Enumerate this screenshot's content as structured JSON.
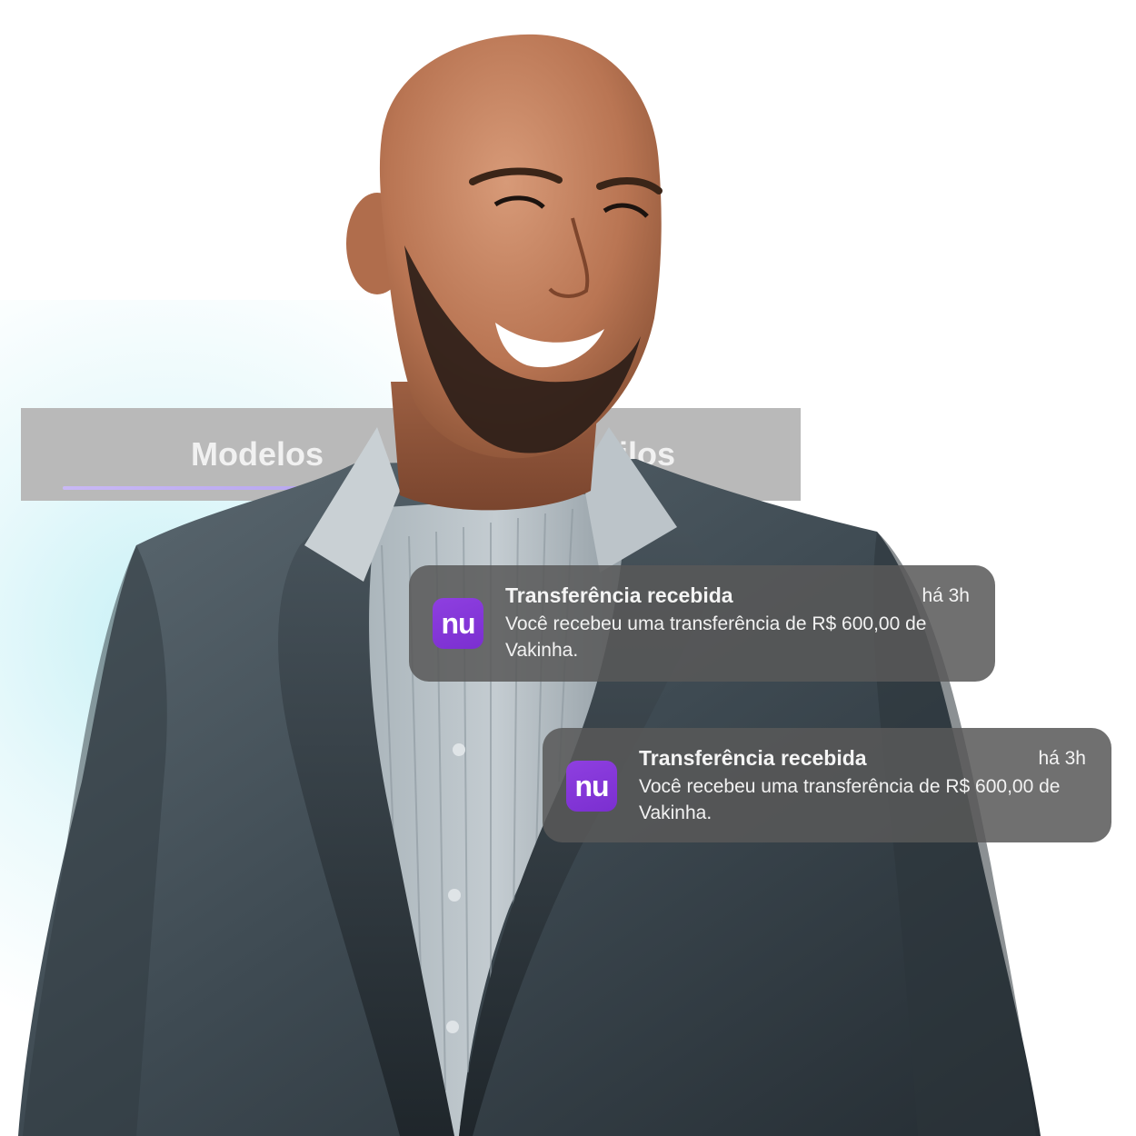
{
  "tabs": {
    "items": [
      {
        "label": "Modelos",
        "active": true
      },
      {
        "label": "ilos",
        "active": false
      }
    ],
    "underline_color": "#b7a6ef"
  },
  "photo": {
    "subject": "smiling bald man with beard in grey suit and striped shirt",
    "glow_color": "#bfeef4"
  },
  "notifications": [
    {
      "app_icon": "nubank-icon",
      "icon_text": "nu",
      "icon_color": "#8a3ddd",
      "title": "Transferência recebida",
      "time": "há 3h",
      "body": "Você recebeu uma transferência de R$ 600,00 de Vakinha."
    },
    {
      "app_icon": "nubank-icon",
      "icon_text": "nu",
      "icon_color": "#8a3ddd",
      "title": "Transferência recebida",
      "time": "há 3h",
      "body": "Você recebeu uma transferência de R$ 600,00 de Vakinha."
    }
  ]
}
